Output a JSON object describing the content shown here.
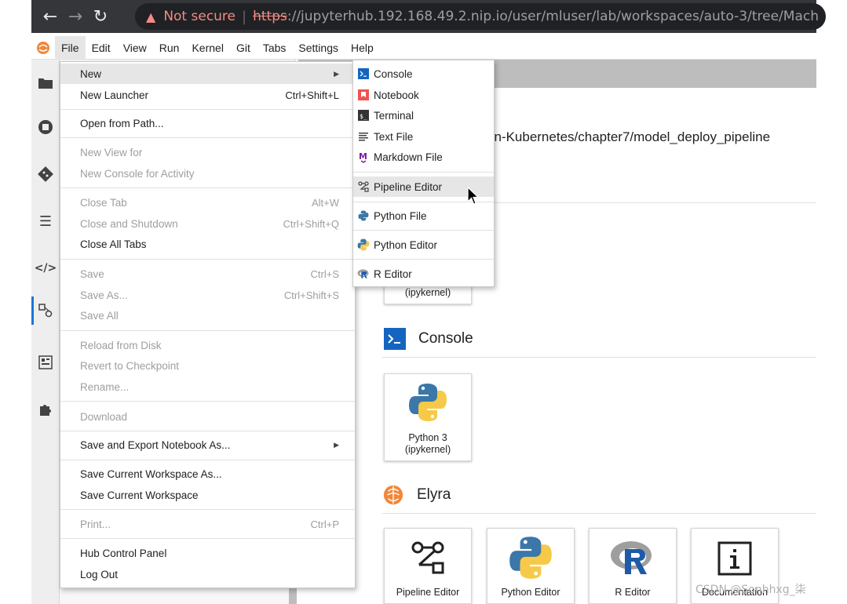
{
  "browser": {
    "back_icon": "arrow-left-icon",
    "forward_icon": "arrow-right-icon",
    "reload_icon": "reload-icon",
    "warning_text": "Not secure",
    "url_scheme": "https",
    "url_rest": "://jupyterhub.192.168.49.2.nip.io/user/mluser/lab/workspaces/auto-3/tree/Mach"
  },
  "menubar": {
    "items": [
      "File",
      "Edit",
      "View",
      "Run",
      "Kernel",
      "Git",
      "Tabs",
      "Settings",
      "Help"
    ],
    "active": "File"
  },
  "file_menu": {
    "new": "New",
    "new_launcher": "New Launcher",
    "new_launcher_sc": "Ctrl+Shift+L",
    "open_from_path": "Open from Path...",
    "new_view_for": "New View for",
    "new_console_activity": "New Console for Activity",
    "close_tab": "Close Tab",
    "close_tab_sc": "Alt+W",
    "close_shutdown": "Close and Shutdown",
    "close_shutdown_sc": "Ctrl+Shift+Q",
    "close_all_tabs": "Close All Tabs",
    "save": "Save",
    "save_sc": "Ctrl+S",
    "save_as": "Save As...",
    "save_as_sc": "Ctrl+Shift+S",
    "save_all": "Save All",
    "reload_disk": "Reload from Disk",
    "revert_checkpoint": "Revert to Checkpoint",
    "rename": "Rename...",
    "download": "Download",
    "save_export": "Save and Export Notebook As...",
    "save_workspace_as": "Save Current Workspace As...",
    "save_workspace": "Save Current Workspace",
    "print": "Print...",
    "print_sc": "Ctrl+P",
    "hub_control": "Hub Control Panel",
    "log_out": "Log Out"
  },
  "new_submenu": {
    "console": "Console",
    "notebook": "Notebook",
    "terminal": "Terminal",
    "text_file": "Text File",
    "markdown_file": "Markdown File",
    "pipeline_editor": "Pipeline Editor",
    "python_file": "Python File",
    "python_editor": "Python Editor",
    "r_editor": "R Editor"
  },
  "launcher": {
    "path": "on-Kubernetes/chapter7/model_deploy_pipeline",
    "notebook_card_partial": "(ipykernel)",
    "console_section": "Console",
    "console_card": "Python 3\n(ipykernel)",
    "console_card_line1": "Python 3",
    "console_card_line2": "(ipykernel)",
    "elyra_section": "Elyra",
    "elyra_cards": [
      "Pipeline Editor",
      "Python Editor",
      "R Editor",
      "Documentation"
    ]
  },
  "watermark": "CSDN @Sonhhxg_柒",
  "colors": {
    "accent": "#1976d2",
    "browser_bg": "#35363a",
    "warning": "#f28b82",
    "python_blue": "#3b77a8",
    "python_yellow": "#f7c948"
  }
}
